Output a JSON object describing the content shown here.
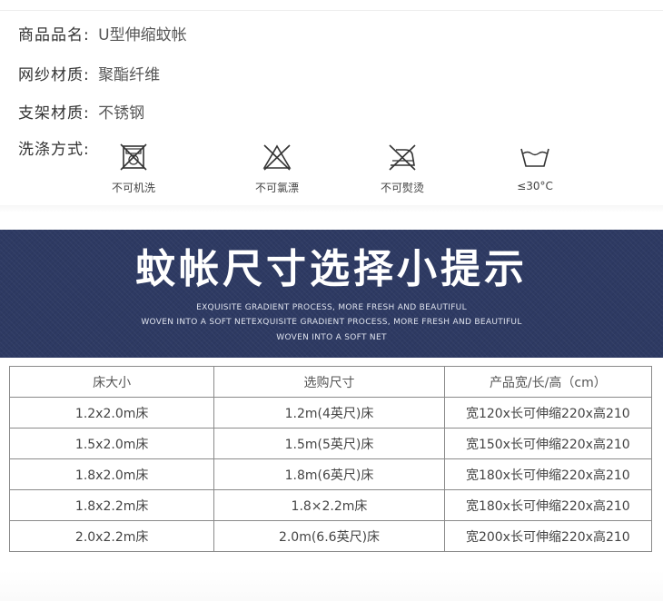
{
  "product_info": {
    "name_label": "商品品名:",
    "name_value": "U型伸缩蚊帐",
    "mesh_label": "网纱材质:",
    "mesh_value": "聚酯纤维",
    "frame_label": "支架材质:",
    "frame_value": "不锈钢",
    "wash_label": "洗涤方式:",
    "wash_items": [
      {
        "icon": "no-machine-wash-icon",
        "label": "不可机洗"
      },
      {
        "icon": "no-bleach-icon",
        "label": "不可氯漂"
      },
      {
        "icon": "no-iron-icon",
        "label": "不可熨烫"
      },
      {
        "icon": "wash-30-icon",
        "label": "≤30°C"
      }
    ]
  },
  "banner": {
    "title": "蚊帐尺寸选择小提示",
    "sub1": "EXQUISITE GRADIENT PROCESS, MORE FRESH AND BEAUTIFUL",
    "sub2": "WOVEN INTO A SOFT NETEXQUISITE GRADIENT PROCESS, MORE FRESH AND BEAUTIFUL",
    "sub3": "WOVEN INTO A SOFT NET",
    "background_color": "#2e3a63"
  },
  "size_table": {
    "headers": [
      "床大小",
      "选购尺寸",
      "产品宽/长/高（cm）"
    ],
    "rows": [
      [
        "1.2x2.0m床",
        "1.2m(4英尺)床",
        "宽120x长可伸缩220x高210"
      ],
      [
        "1.5x2.0m床",
        "1.5m(5英尺)床",
        "宽150x长可伸缩220x高210"
      ],
      [
        "1.8x2.0m床",
        "1.8m(6英尺)床",
        "宽180x长可伸缩220x高210"
      ],
      [
        "1.8x2.2m床",
        "1.8×2.2m床",
        "宽180x长可伸缩220x高210"
      ],
      [
        "2.0x2.2m床",
        "2.0m(6.6英尺)床",
        "宽200x长可伸缩220x高210"
      ]
    ]
  }
}
